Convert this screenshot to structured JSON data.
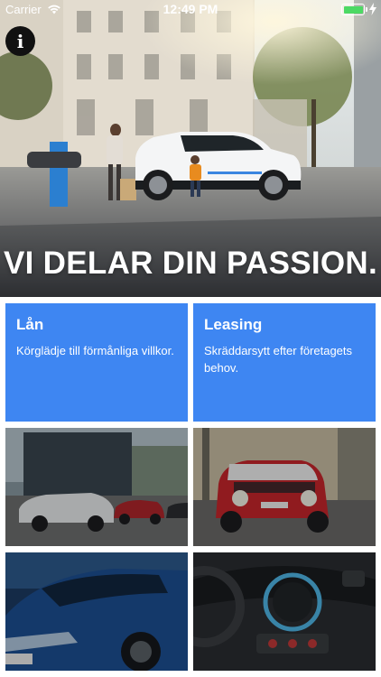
{
  "status_bar": {
    "carrier": "Carrier",
    "time": "12:49 PM",
    "battery_level": 1.0
  },
  "hero": {
    "headline": "VI DELAR DIN PASSION."
  },
  "tiles": [
    {
      "title": "Lån",
      "text": "Körglädje till förmånliga villkor."
    },
    {
      "title": "Leasing",
      "text": "Skräddarsytt efter företagets behov."
    }
  ],
  "colors": {
    "tile_blue": "#3e86f2",
    "battery_green": "#4cd964"
  },
  "icons": [
    "info-icon",
    "wifi-icon",
    "battery-icon",
    "charging-bolt-icon"
  ]
}
